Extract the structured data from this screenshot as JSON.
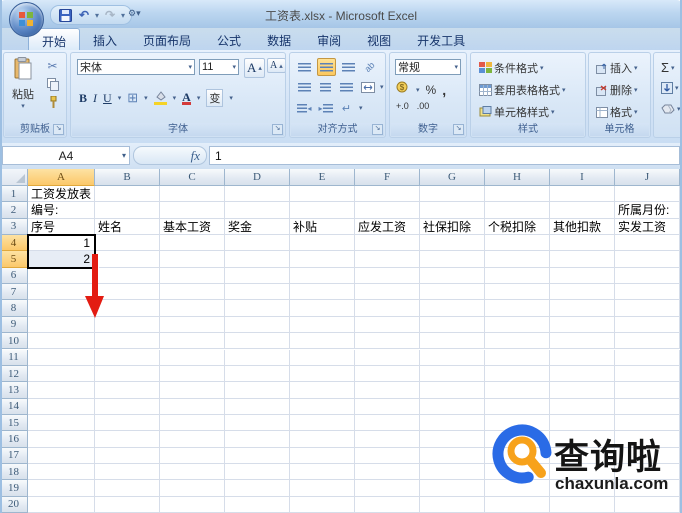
{
  "window": {
    "title": "工资表.xlsx - Microsoft Excel"
  },
  "tabs": [
    {
      "label": "开始",
      "active": true
    },
    {
      "label": "插入"
    },
    {
      "label": "页面布局"
    },
    {
      "label": "公式"
    },
    {
      "label": "数据"
    },
    {
      "label": "审阅"
    },
    {
      "label": "视图"
    },
    {
      "label": "开发工具"
    }
  ],
  "ribbon": {
    "clipboard": {
      "label": "剪贴板",
      "paste_label": "粘贴"
    },
    "font": {
      "label": "字体",
      "family": "宋体",
      "size": "11",
      "bold": "B",
      "italic": "I",
      "underline": "U",
      "phonetic": "变",
      "grow": "A",
      "shrink": "A"
    },
    "alignment": {
      "label": "对齐方式"
    },
    "number": {
      "label": "数字",
      "format": "常规",
      "percent": "%",
      "comma": ",",
      "inc_decimal": "+.0",
      "dec_decimal": ".00"
    },
    "styles": {
      "label": "样式",
      "items": [
        "条件格式",
        "套用表格格式",
        "单元格样式"
      ]
    },
    "cells": {
      "label": "单元格",
      "items": [
        "插入",
        "删除",
        "格式"
      ]
    },
    "editing": {
      "sigma": "Σ"
    }
  },
  "formula_bar": {
    "name_box": "A4",
    "fx": "fx",
    "value": "1"
  },
  "sheet": {
    "columns": [
      "A",
      "B",
      "C",
      "D",
      "E",
      "F",
      "G",
      "H",
      "I",
      "J"
    ],
    "row_count": 20,
    "selection": {
      "range": "A4:A5",
      "active_cell": "A4",
      "col_index": 0,
      "row_start": 4,
      "row_end": 5
    },
    "cells": [
      {
        "ref": "A1",
        "text": "工资发放表",
        "align": "left"
      },
      {
        "ref": "A2",
        "text": "编号:",
        "align": "left"
      },
      {
        "ref": "J2",
        "text": "所属月份:",
        "align": "left"
      },
      {
        "ref": "A3",
        "text": "序号",
        "align": "left"
      },
      {
        "ref": "B3",
        "text": "姓名",
        "align": "left"
      },
      {
        "ref": "C3",
        "text": "基本工资",
        "align": "left"
      },
      {
        "ref": "D3",
        "text": "奖金",
        "align": "left"
      },
      {
        "ref": "E3",
        "text": "补贴",
        "align": "left"
      },
      {
        "ref": "F3",
        "text": "应发工资",
        "align": "left"
      },
      {
        "ref": "G3",
        "text": "社保扣除",
        "align": "left"
      },
      {
        "ref": "H3",
        "text": "个税扣除",
        "align": "left"
      },
      {
        "ref": "I3",
        "text": "其他扣款",
        "align": "left"
      },
      {
        "ref": "J3",
        "text": "实发工资",
        "align": "left"
      },
      {
        "ref": "A4",
        "text": "1",
        "align": "right"
      },
      {
        "ref": "A5",
        "text": "2",
        "align": "right"
      }
    ]
  },
  "annotation": {
    "type": "fill-down-arrow",
    "color": "#e31c12"
  },
  "watermark": {
    "title": "查询啦",
    "domain": "chaxunla.com",
    "ring_color": "#2a6be6",
    "lens_color": "#f7a21b"
  }
}
